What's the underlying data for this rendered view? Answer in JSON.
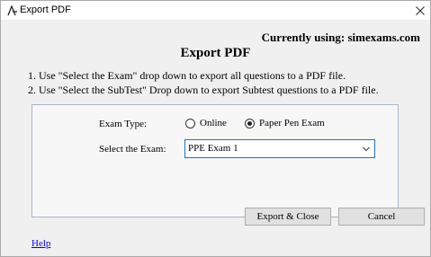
{
  "window": {
    "title": "Export PDF",
    "icon": "app-logo-icon",
    "close_icon": "close-icon"
  },
  "header": {
    "currently_using": "Currently using: simexams.com",
    "title": "Export PDF"
  },
  "instructions": [
    "1. Use \"Select the Exam\"  drop down to export all questions to a PDF file.",
    "2. Use \"Select the SubTest\" Drop down to export Subtest questions to a PDF file."
  ],
  "form": {
    "exam_type_label": "Exam Type:",
    "exam_type_options": [
      {
        "label": "Online",
        "selected": false
      },
      {
        "label": "Paper Pen Exam",
        "selected": true
      }
    ],
    "select_exam_label": "Select the Exam:",
    "select_exam_value": "PPE Exam 1",
    "select_accent": "#1e6fcf"
  },
  "buttons": {
    "export_close": "Export & Close",
    "cancel": "Cancel"
  },
  "footer": {
    "help_link": "Help",
    "link_color": "#0000ee"
  }
}
